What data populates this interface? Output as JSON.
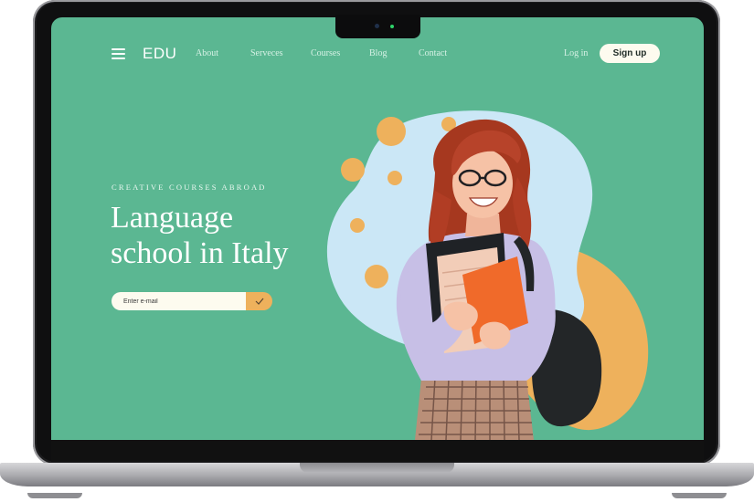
{
  "nav": {
    "logo": "EDU",
    "links": [
      "About",
      "Serveces",
      "Courses",
      "Blog",
      "Contact"
    ],
    "login_label": "Log in",
    "signup_label": "Sign up"
  },
  "hero": {
    "kicker": "CREATIVE COURSES ABROAD",
    "title_line1": "Language",
    "title_line2": "school in Italy",
    "email_placeholder": "Enter e-mail"
  },
  "colors": {
    "background": "#5bb792",
    "blob_blue": "#cbe7f6",
    "accent_orange": "#eeb15c",
    "button_cream": "#fdfbef"
  },
  "icons": [
    "menu-icon",
    "checkmark-icon"
  ]
}
